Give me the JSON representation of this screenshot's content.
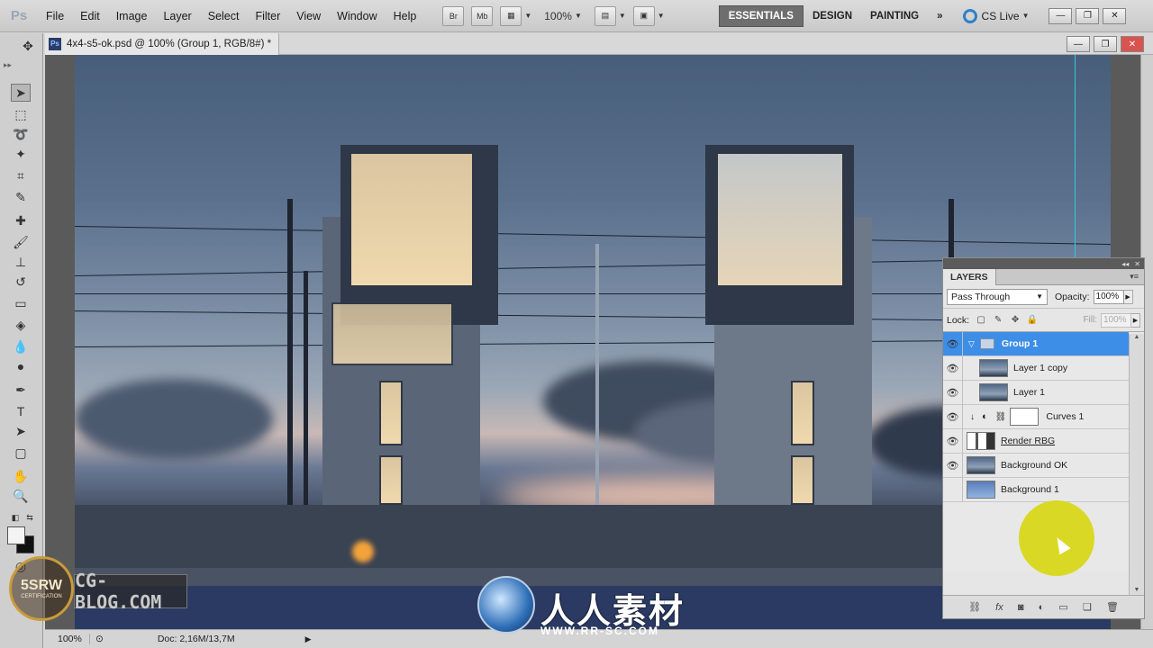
{
  "app": {
    "logo": "Ps"
  },
  "menu": [
    "File",
    "Edit",
    "Image",
    "Layer",
    "Select",
    "Filter",
    "View",
    "Window",
    "Help"
  ],
  "toolbar": {
    "bridge": "Br",
    "minibridge": "Mb",
    "zoom": "100%"
  },
  "workspaces": [
    "ESSENTIALS",
    "DESIGN",
    "PAINTING"
  ],
  "cslive": "CS Live",
  "document": {
    "title": "4x4-s5-ok.psd @ 100% (Group 1, RGB/8#) *"
  },
  "status": {
    "zoom": "100%",
    "doc_size": "Doc: 2,16M/13,7M"
  },
  "layers_panel": {
    "tab": "LAYERS",
    "blend_mode": "Pass Through",
    "opacity_label": "Opacity:",
    "opacity": "100%",
    "lock_label": "Lock:",
    "fill_label": "Fill:",
    "fill": "100%",
    "layers": [
      {
        "name": "Group 1",
        "visible": true,
        "selected": true,
        "type": "group"
      },
      {
        "name": "Layer 1 copy",
        "visible": true,
        "selected": false,
        "type": "pixel"
      },
      {
        "name": "Layer 1",
        "visible": true,
        "selected": false,
        "type": "pixel"
      },
      {
        "name": "Curves 1",
        "visible": true,
        "selected": false,
        "type": "adjustment"
      },
      {
        "name": "Render RBG",
        "visible": true,
        "selected": false,
        "type": "smart"
      },
      {
        "name": "Background OK",
        "visible": true,
        "selected": false,
        "type": "pixel"
      },
      {
        "name": "Background 1",
        "visible": false,
        "selected": false,
        "type": "pixel"
      }
    ]
  },
  "watermarks": {
    "badge_main": "5SRW",
    "badge_sub": "CERTIFICATION",
    "cgblog": "CG-BLOG.COM",
    "cn": "人人素材",
    "url": "WWW.RR-SC.COM"
  }
}
